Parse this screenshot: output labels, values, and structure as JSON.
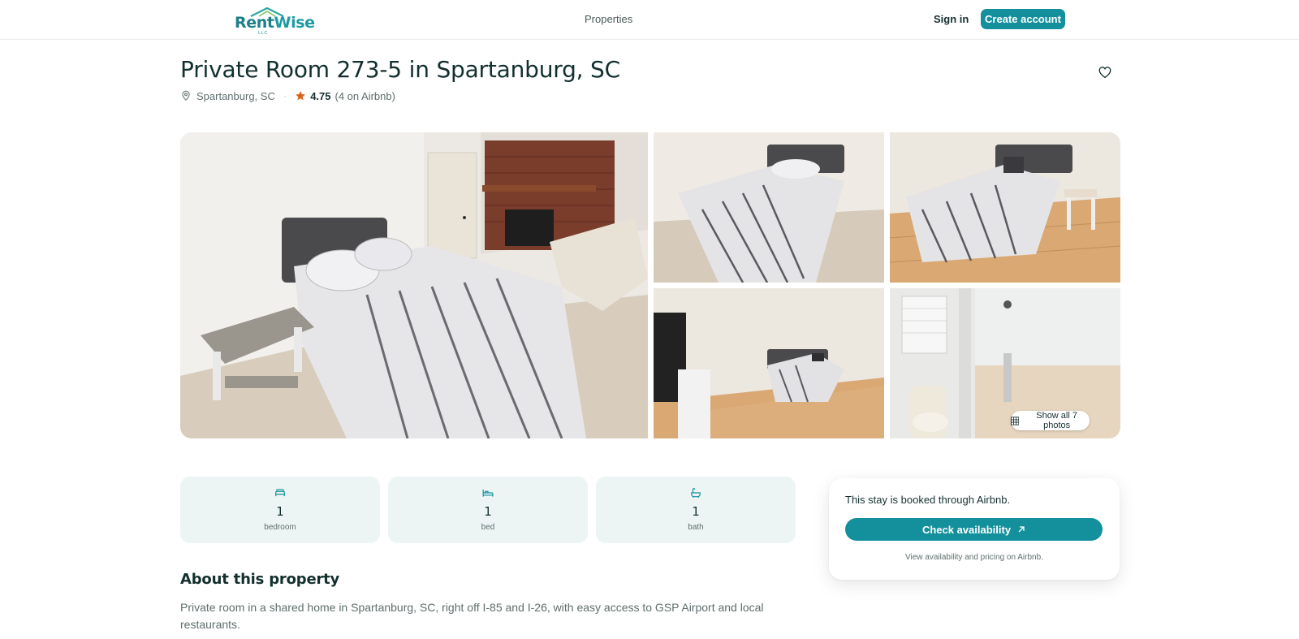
{
  "header": {
    "logo_text_rent": "Rent",
    "logo_text_wise": "Wise",
    "logo_sub": "LLC",
    "nav_properties": "Properties",
    "sign_in": "Sign in",
    "create_account": "Create account"
  },
  "listing": {
    "title": "Private Room 273-5 in Spartanburg, SC",
    "location": "Spartanburg, SC",
    "rating": "4.75",
    "reviews": "(4 on Airbnb)"
  },
  "gallery": {
    "show_all": "Show all 7 photos"
  },
  "stats": [
    {
      "value": "1",
      "label": "bedroom",
      "icon": "bedroom-icon"
    },
    {
      "value": "1",
      "label": "bed",
      "icon": "bed-icon"
    },
    {
      "value": "1",
      "label": "bath",
      "icon": "bath-icon"
    }
  ],
  "about": {
    "heading": "About this property",
    "text": "Private room in a shared home in Spartanburg, SC, right off I-85 and I-26, with easy access to GSP Airport and local restaurants."
  },
  "booking": {
    "note": "This stay is booked through Airbnb.",
    "button": "Check availability",
    "sub": "View availability and pricing on Airbnb."
  },
  "colors": {
    "accent": "#13909c",
    "star": "#d9641e",
    "stat_bg": "#edf5f4"
  }
}
